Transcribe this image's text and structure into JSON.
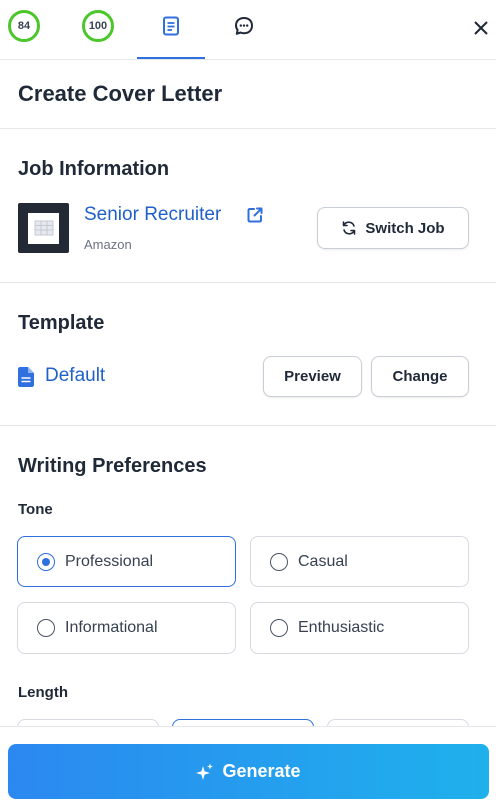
{
  "scores": {
    "first": "84",
    "second": "100"
  },
  "header": {
    "page_title": "Create Cover Letter"
  },
  "job": {
    "section_title": "Job Information",
    "title": "Senior Recruiter",
    "company": "Amazon",
    "switch_label": "Switch Job"
  },
  "template": {
    "section_title": "Template",
    "name": "Default",
    "preview_label": "Preview",
    "change_label": "Change"
  },
  "preferences": {
    "section_title": "Writing Preferences",
    "tone_label": "Tone",
    "tone_options": [
      {
        "label": "Professional",
        "selected": true
      },
      {
        "label": "Casual",
        "selected": false
      },
      {
        "label": "Informational",
        "selected": false
      },
      {
        "label": "Enthusiastic",
        "selected": false
      }
    ],
    "length_label": "Length"
  },
  "generate_label": "Generate",
  "colors": {
    "accent": "#2f6fde",
    "link": "#2160c8",
    "score_ring": "#4bc62b"
  },
  "icons": [
    "document-icon",
    "chat-icon",
    "close-icon",
    "building-icon",
    "external-link-icon",
    "switch-icon",
    "file-icon",
    "sparkle-icon"
  ]
}
